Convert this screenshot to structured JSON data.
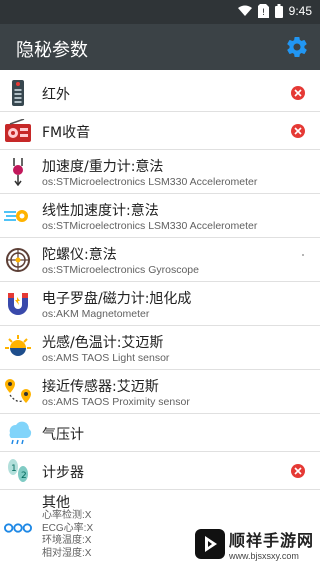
{
  "status": {
    "time": "9:45"
  },
  "app": {
    "title": "隐秘参数"
  },
  "rows": [
    {
      "title": "红外",
      "sub": ""
    },
    {
      "title": "FM收音",
      "sub": ""
    },
    {
      "title": "加速度/重力计:意法",
      "sub": "os:STMicroelectronics LSM330 Accelerometer"
    },
    {
      "title": "线性加速度计:意法",
      "sub": "os:STMicroelectronics LSM330 Accelerometer"
    },
    {
      "title": "陀螺仪:意法",
      "sub": "os:STMicroelectronics Gyroscope"
    },
    {
      "title": "电子罗盘/磁力计:旭化成",
      "sub": "os:AKM Magnetometer"
    },
    {
      "title": "光感/色温计:艾迈斯",
      "sub": "os:AMS TAOS Light sensor"
    },
    {
      "title": "接近传感器:艾迈斯",
      "sub": "os:AMS TAOS Proximity sensor"
    },
    {
      "title": "气压计",
      "sub": ""
    },
    {
      "title": "计步器",
      "sub": ""
    },
    {
      "title": "其他",
      "sub": ""
    }
  ],
  "other_items": [
    "心率检测:X",
    "ECG心率:X",
    "环境温度:X",
    "相对湿度:X"
  ],
  "watermark": {
    "name": "顺祥手游网",
    "url": "www.bjsxsxy.com"
  },
  "colors": {
    "status_bar": "#2f3437",
    "app_bar": "#3b4246",
    "accent": "#1e88e5",
    "error": "#e53935"
  }
}
